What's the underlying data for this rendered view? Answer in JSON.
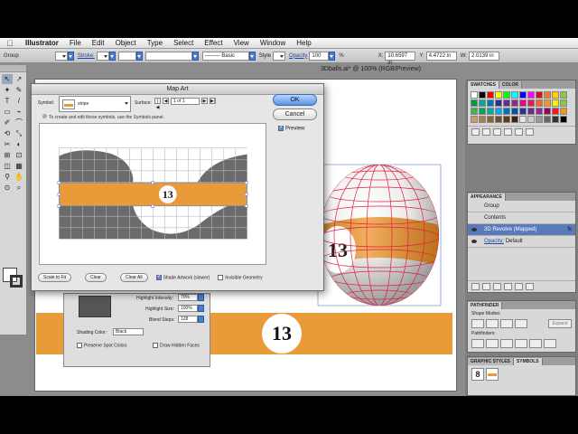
{
  "menubar": {
    "apple": "",
    "items": [
      "Illustrator",
      "File",
      "Edit",
      "Object",
      "Type",
      "Select",
      "Effect",
      "View",
      "Window",
      "Help"
    ]
  },
  "controlbar": {
    "selection": "Group",
    "stroke_label": "Stroke:",
    "brush_value": "Basic",
    "style_label": "Style",
    "opacity_label": "Opacity",
    "opacity_value": "100",
    "opacity_unit": "%",
    "x_label": "X:",
    "x_value": "10.6597 in",
    "y_label": "Y:",
    "y_value": "4.4722 in",
    "w_label": "W:",
    "w_value": "2.0139 in"
  },
  "document": {
    "title": "3Dballs.ai* @ 100% (RGB/Preview)",
    "ball_number": "13",
    "bar_number": "13"
  },
  "tools": [
    "↖",
    "↗",
    "✦",
    "✎",
    "T",
    "/",
    "▭",
    "⌁",
    "✐",
    "⌒",
    "⟲",
    "⤡",
    "✂",
    "◐",
    "⊞",
    "⊡",
    "◫",
    "▦",
    "⚲",
    "✋",
    "⊙",
    "⌕"
  ],
  "mapart": {
    "title": "Map Art",
    "symbol_label": "Symbol:",
    "symbol_value": "stripe",
    "surface_label": "Surface:",
    "surface_value": "1 of 1",
    "info": "To create and edit these symbols, use the Symbols panel.",
    "ok": "OK",
    "cancel": "Cancel",
    "preview": "Preview",
    "label_number": "13",
    "scale_to_fit": "Scale to Fit",
    "clear": "Clear",
    "clear_all": "Clear All",
    "shade_artwork": "Shade Artwork (slower)",
    "invisible_geometry": "Invisible Geometry"
  },
  "back_dialog": {
    "highlight_intensity_label": "Highlight Intensity:",
    "highlight_intensity": "70%",
    "highlight_size_label": "Highlight Size:",
    "highlight_size": "100%",
    "blend_steps_label": "Blend Steps:",
    "blend_steps": "128",
    "shading_color_label": "Shading Color:",
    "shading_color": "Black",
    "preserve_spot": "Preserve Spot Colors",
    "draw_hidden": "Draw Hidden Faces"
  },
  "panels": {
    "swatches_tab": "SWATCHES",
    "color_tab": "COLOR",
    "appearance_tab": "APPEARANCE",
    "appearance_group": "Group",
    "appearance_contents": "Contents",
    "appearance_effect": "3D Revolve (Mapped)",
    "appearance_fx": "fx",
    "appearance_opacity": "Opacity:",
    "appearance_opacity_value": "Default",
    "pathfinder_tab": "PATHFINDER",
    "shape_modes": "Shape Modes:",
    "pathfinders": "Pathfinders:",
    "expand": "Expand",
    "graphic_styles_tab": "GRAPHIC STYLES",
    "symbols_tab": "SYMBOLS",
    "symbol_count": "8"
  },
  "colors": {
    "accent": "#e99b39",
    "selection_blue": "#5a79b8",
    "wire": "#e0203a"
  }
}
